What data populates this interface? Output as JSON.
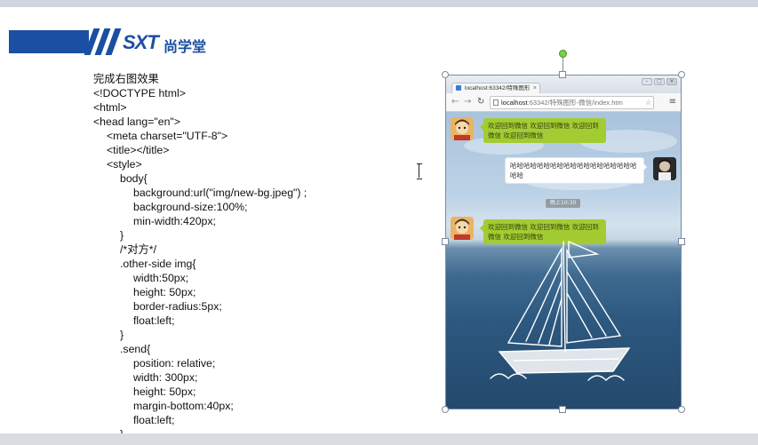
{
  "logo": {
    "brand": "SXT",
    "brand_cn": "尚学堂"
  },
  "code_lines": [
    {
      "indent": 0,
      "text": "完成右图效果"
    },
    {
      "indent": 0,
      "text": "<!DOCTYPE html>"
    },
    {
      "indent": 0,
      "text": "<html>"
    },
    {
      "indent": 0,
      "text": "<head lang=\"en\">"
    },
    {
      "indent": 1,
      "text": "<meta charset=\"UTF-8\">"
    },
    {
      "indent": 1,
      "text": "<title></title>"
    },
    {
      "indent": 1,
      "text": "<style>"
    },
    {
      "indent": 2,
      "text": "body{"
    },
    {
      "indent": 3,
      "text": "background:url(\"img/new-bg.jpeg\") ;"
    },
    {
      "indent": 3,
      "text": "background-size:100%;"
    },
    {
      "indent": 3,
      "text": "min-width:420px;"
    },
    {
      "indent": 2,
      "text": "}"
    },
    {
      "indent": 2,
      "text": "/*对方*/"
    },
    {
      "indent": 2,
      "text": ".other-side img{"
    },
    {
      "indent": 3,
      "text": "width:50px;"
    },
    {
      "indent": 3,
      "text": "height: 50px;"
    },
    {
      "indent": 3,
      "text": "border-radius:5px;"
    },
    {
      "indent": 3,
      "text": "float:left;"
    },
    {
      "indent": 2,
      "text": "}"
    },
    {
      "indent": 2,
      "text": ".send{"
    },
    {
      "indent": 3,
      "text": "position: relative;"
    },
    {
      "indent": 3,
      "text": "width: 300px;"
    },
    {
      "indent": 3,
      "text": "height: 50px;"
    },
    {
      "indent": 3,
      "text": "margin-bottom:40px;"
    },
    {
      "indent": 3,
      "text": "float:left;"
    },
    {
      "indent": 2,
      "text": "}"
    }
  ],
  "browser": {
    "tab_title": "localhost:63342/特殊图形",
    "url_host": "localhost",
    "url_rest": ":63342/特殊图形-微信/index.htm",
    "chat": {
      "msg1": "欢迎回到微信 欢迎回到微信 欢迎回到微信 欢迎回到微信",
      "msg2": "哈哈哈哈哈哈哈哈哈哈哈哈哈哈哈哈哈哈哈哈哈",
      "time": "晚上10:30",
      "msg3": "欢迎回到微信 欢迎回到微信 欢迎回到微信 欢迎回到微信"
    }
  },
  "colors": {
    "brand_blue": "#1b4fa3",
    "bubble_green": "#a3cc32",
    "handle_green": "#7ad04b"
  }
}
